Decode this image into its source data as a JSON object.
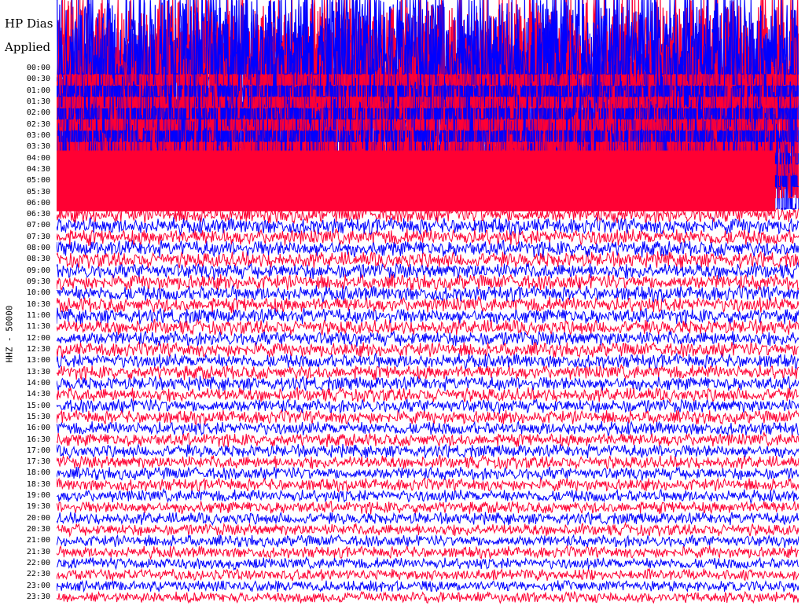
{
  "header": {
    "line1": "HP Dias",
    "line2": "Applied"
  },
  "colors": {
    "background": "#ffffff",
    "trace_a": "#ff0033",
    "trace_b": "#0000ff",
    "text": "#000000"
  },
  "chart_data": {
    "type": "line",
    "title": "",
    "ylabel": "HHZ - 50000",
    "xlabel": "",
    "grid": false,
    "y_tick_labels": [
      "00:00",
      "00:30",
      "01:00",
      "01:30",
      "02:00",
      "02:30",
      "03:00",
      "03:30",
      "04:00",
      "04:30",
      "05:00",
      "05:30",
      "06:00",
      "06:30",
      "07:00",
      "07:30",
      "08:00",
      "08:30",
      "09:00",
      "09:30",
      "10:00",
      "10:30",
      "11:00",
      "11:30",
      "12:00",
      "12:30",
      "13:00",
      "13:30",
      "14:00",
      "14:30",
      "15:00",
      "15:30",
      "16:00",
      "16:30",
      "17:00",
      "17:30",
      "18:00",
      "18:30",
      "19:00",
      "19:30",
      "20:00",
      "20:30",
      "21:00",
      "21:30",
      "22:00",
      "22:30",
      "23:00",
      "23:30"
    ],
    "trace_colors_alternating": [
      "#0000ff",
      "#ff0033"
    ],
    "saturated_rows": [
      "00:00",
      "00:30",
      "01:00",
      "01:30",
      "02:00",
      "02:30",
      "03:00",
      "03:30",
      "04:00",
      "04:30",
      "05:00",
      "05:30",
      "06:00"
    ]
  }
}
